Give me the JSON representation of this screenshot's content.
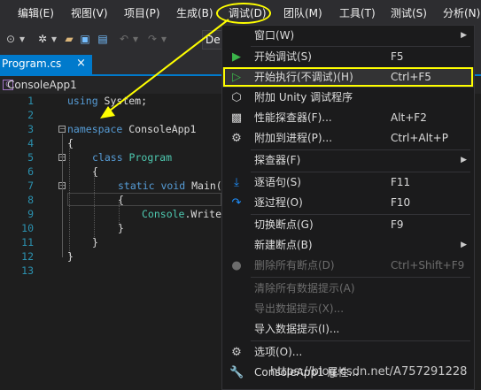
{
  "menubar": {
    "items": [
      "编辑(E)",
      "视图(V)",
      "项目(P)",
      "生成(B)",
      "调试(D)",
      "团队(M)",
      "工具(T)",
      "测试(S)",
      "分析(N)"
    ]
  },
  "toolbar": {
    "config_partial": "De"
  },
  "tab": {
    "title": "Program.cs",
    "close": "×"
  },
  "navbar": {
    "project": "ConsoleApp1"
  },
  "editor": {
    "line_numbers": [
      "1",
      "2",
      "3",
      "4",
      "5",
      "6",
      "7",
      "8",
      "9",
      "10",
      "11",
      "12",
      "13"
    ],
    "lines": {
      "l1_kw": "using",
      "l1_tx": " System;",
      "l3_kw": "namespace",
      "l3_tx": " ConsoleApp1",
      "l4": "{",
      "l5_kw": "class",
      "l5_ty": " Program",
      "l6": "{",
      "l7_kw": "static void",
      "l7_tx": " Main(",
      "l8": "{",
      "l9_ty": "Console",
      "l9_tx": ".Write",
      "l10": "}",
      "l11": "}",
      "l12": "}"
    }
  },
  "debug_menu": {
    "items": [
      {
        "label": "窗口(W)",
        "shortcut": "",
        "icon": "none",
        "submenu": true,
        "disabled": false
      },
      {
        "label": "开始调试(S)",
        "shortcut": "F5",
        "icon": "play-icon",
        "submenu": false,
        "disabled": false
      },
      {
        "label": "开始执行(不调试)(H)",
        "shortcut": "Ctrl+F5",
        "icon": "play-outline-icon",
        "submenu": false,
        "disabled": false
      },
      {
        "label": "附加 Unity 调试程序",
        "shortcut": "",
        "icon": "unity-icon",
        "submenu": false,
        "disabled": false
      },
      {
        "label": "性能探查器(F)...",
        "shortcut": "Alt+F2",
        "icon": "profiler-icon",
        "submenu": false,
        "disabled": false
      },
      {
        "label": "附加到进程(P)...",
        "shortcut": "Ctrl+Alt+P",
        "icon": "attach-process-icon",
        "submenu": false,
        "disabled": false
      },
      {
        "label": "探查器(F)",
        "shortcut": "",
        "icon": "none",
        "submenu": true,
        "disabled": false
      },
      {
        "label": "逐语句(S)",
        "shortcut": "F11",
        "icon": "step-into-icon",
        "submenu": false,
        "disabled": false
      },
      {
        "label": "逐过程(O)",
        "shortcut": "F10",
        "icon": "step-over-icon",
        "submenu": false,
        "disabled": false
      },
      {
        "label": "切换断点(G)",
        "shortcut": "F9",
        "icon": "none",
        "submenu": false,
        "disabled": false
      },
      {
        "label": "新建断点(B)",
        "shortcut": "",
        "icon": "none",
        "submenu": true,
        "disabled": false
      },
      {
        "label": "删除所有断点(D)",
        "shortcut": "Ctrl+Shift+F9",
        "icon": "delete-breakpoints-icon",
        "submenu": false,
        "disabled": true
      },
      {
        "label": "清除所有数据提示(A)",
        "shortcut": "",
        "icon": "none",
        "submenu": false,
        "disabled": true
      },
      {
        "label": "导出数据提示(X)...",
        "shortcut": "",
        "icon": "none",
        "submenu": false,
        "disabled": true
      },
      {
        "label": "导入数据提示(I)...",
        "shortcut": "",
        "icon": "none",
        "submenu": false,
        "disabled": false
      },
      {
        "label": "选项(O)...",
        "shortcut": "",
        "icon": "gear-icon",
        "submenu": false,
        "disabled": false
      },
      {
        "label": "ConsoleApp1 属性...",
        "shortcut": "",
        "icon": "wrench-icon",
        "submenu": false,
        "disabled": false
      }
    ]
  },
  "watermark": "https://blog.csdn.net/A757291228",
  "colors": {
    "accent": "#007acc",
    "highlight": "#ffff00",
    "play_green": "#3bb44a",
    "step_blue": "#1e90ff"
  }
}
